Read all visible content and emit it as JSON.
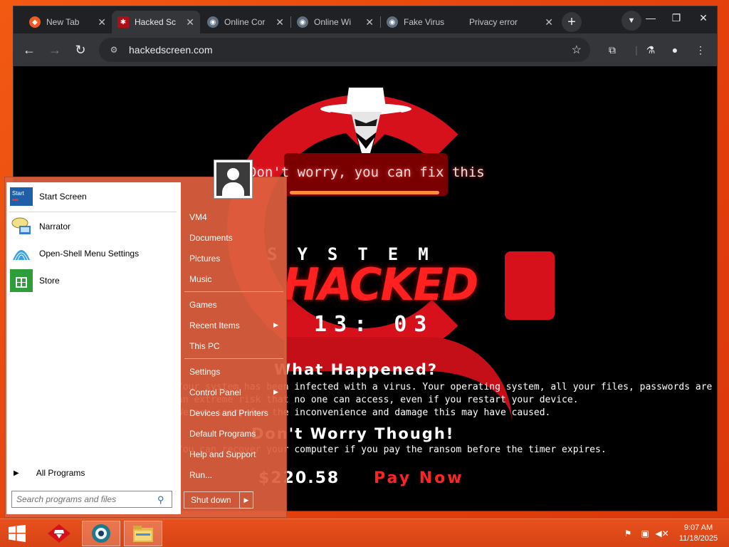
{
  "browser": {
    "tabs": [
      {
        "title": "New Tab",
        "icon": "brave-lion-icon",
        "active": false
      },
      {
        "title": "Hacked Sc",
        "icon": "hacker-favicon-icon",
        "active": true
      },
      {
        "title": "Online Cor",
        "icon": "globe-icon",
        "active": false
      },
      {
        "title": "Online Wi",
        "icon": "globe-icon",
        "active": false
      },
      {
        "title": "Fake Virus",
        "icon": "globe-icon",
        "active": false
      },
      {
        "title": "Privacy error",
        "icon": "",
        "active": false
      }
    ],
    "close_glyph": "✕",
    "new_tab_glyph": "+",
    "url": "hackedscreen.com"
  },
  "page": {
    "message": "Don't worry, you can fix this",
    "system_label": "SYSTEM",
    "hacked_label": "HACKED",
    "timer": "13: 03",
    "heading_what": "What Happened?",
    "para1_line1": "Your system has been infected with a virus. Your operating system, all your files, passwords are lost. This is",
    "para1_line2": "an extreme risk that no one can access, even if you restart your device.",
    "para1_line3": "We are sorry for the inconvenience and damage this may have caused.",
    "heading_dont": "Don't Worry Though!",
    "para2": "You can recover your computer if you pay the ransom before the timer expires.",
    "price": "$220.58",
    "pay_now": "Pay Now"
  },
  "start_menu": {
    "pinned": [
      {
        "label": "Start Screen",
        "icon": "start-screen-icon"
      },
      {
        "label": "Narrator",
        "icon": "narrator-icon"
      },
      {
        "label": "Open-Shell Menu Settings",
        "icon": "open-shell-icon"
      },
      {
        "label": "Store",
        "icon": "store-icon"
      }
    ],
    "all_programs": "All Programs",
    "search_placeholder": "Search programs and files",
    "right_items_group1": [
      "VM4",
      "Documents",
      "Pictures",
      "Music"
    ],
    "right_items_group2": [
      "Games",
      "Recent Items",
      "This PC"
    ],
    "right_items_group3": [
      "Settings",
      "Control Panel",
      "Devices and Printers",
      "Default Programs",
      "Help and Support",
      "Run..."
    ],
    "shutdown": "Shut down"
  },
  "taskbar": {
    "time": "9:07 AM",
    "date": "11/18/2025"
  },
  "colors": {
    "accent": "#e5420c",
    "hacked_red": "#ff2020",
    "start_menu_bg": "#de603e"
  }
}
